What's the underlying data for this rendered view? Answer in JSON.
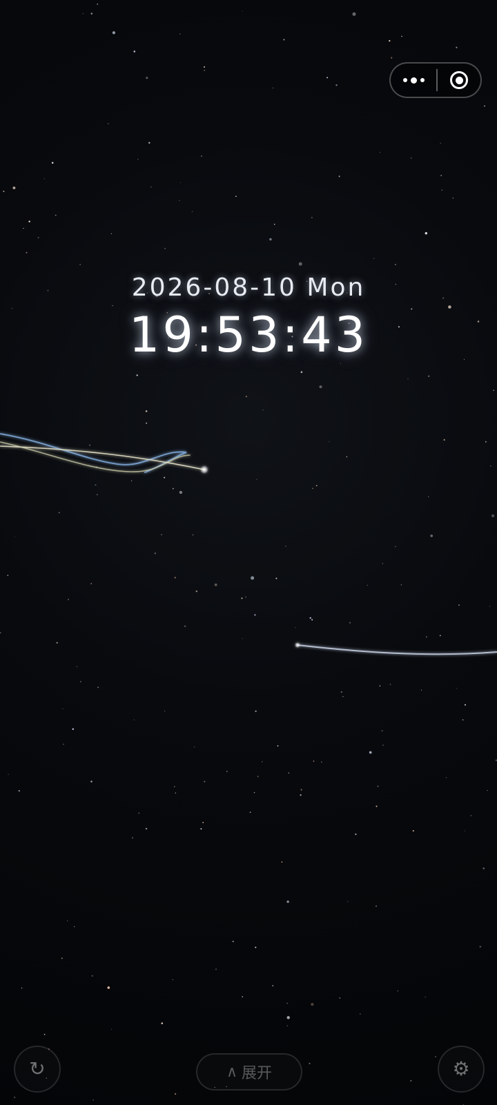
{
  "clock": {
    "date": "2026-08-10 Mon",
    "time": "19:53:43"
  },
  "capsule": {
    "more_icon": "more-dots-icon",
    "close_icon": "target-circle-icon"
  },
  "bottom_bar": {
    "expand_label": "展开",
    "expand_icon": "∧",
    "refresh_icon": "↻",
    "settings_icon": "⚙"
  },
  "theme": {
    "background": "#050608",
    "text": "#ffffff",
    "trail_blue": "#7fa8d6",
    "trail_yellow": "#d8d2a0"
  }
}
